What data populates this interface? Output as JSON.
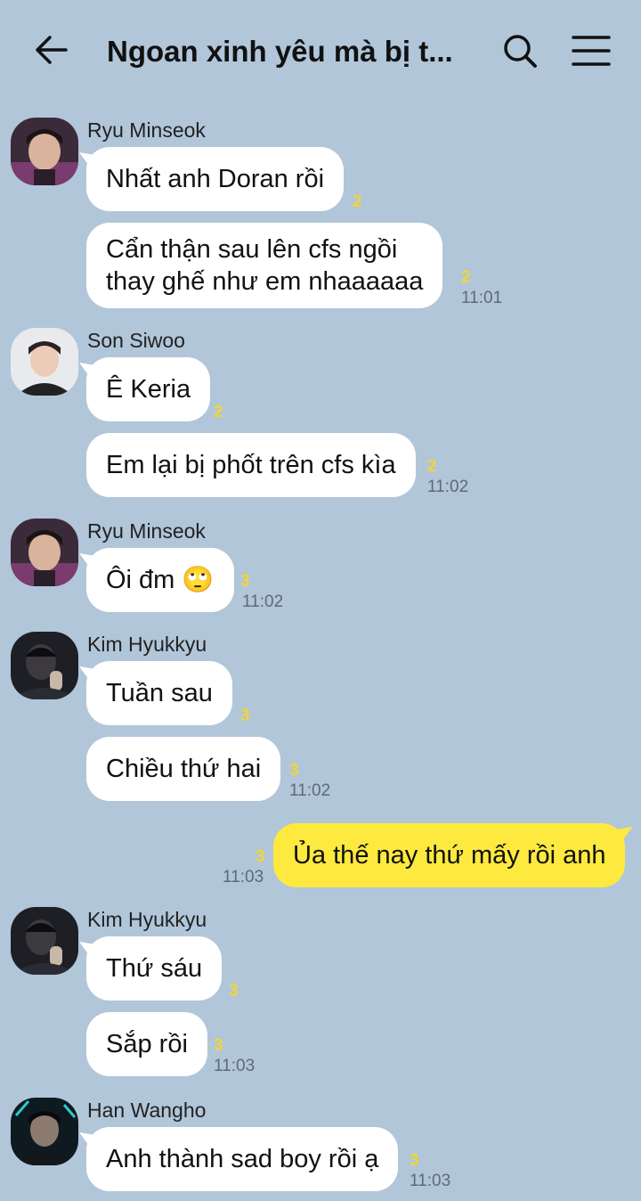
{
  "header": {
    "title": "Ngoan xinh yêu mà bị t..."
  },
  "messages": {
    "g1": {
      "sender": "Ryu Minseok",
      "m1": "Nhất anh Doran rồi",
      "m1_unread": "2",
      "m2_line1": "Cẩn thận sau lên cfs ngồi",
      "m2_line2": "thay ghế như em nhaaaaaa",
      "m2_unread": "2",
      "m2_time": "11:01"
    },
    "g2": {
      "sender": "Son Siwoo",
      "m1": "Ê Keria",
      "m1_unread": "2",
      "m2": "Em lại bị phốt trên cfs kìa",
      "m2_unread": "2",
      "m2_time": "11:02"
    },
    "g3": {
      "sender": "Ryu Minseok",
      "m1": "Ôi đm 🙄",
      "m1_unread": "3",
      "m1_time": "11:02"
    },
    "g4": {
      "sender": "Kim Hyukkyu",
      "m1": "Tuần sau",
      "m1_unread": "3",
      "m2": "Chiều thứ hai",
      "m2_unread": "3",
      "m2_time": "11:02"
    },
    "me1": {
      "text": "Ủa thế nay thứ mấy rồi anh",
      "unread": "3",
      "time": "11:03"
    },
    "g5": {
      "sender": "Kim Hyukkyu",
      "m1": "Thứ sáu",
      "m1_unread": "3",
      "m2": "Sắp rồi",
      "m2_unread": "3",
      "m2_time": "11:03"
    },
    "g6": {
      "sender": "Han Wangho",
      "m1": "Anh thành sad boy rồi ạ",
      "m1_unread": "3",
      "m1_time": "11:03"
    }
  },
  "colors": {
    "background": "#b1c6d9",
    "bubble_mine": "#fee93e",
    "bubble_other": "#ffffff",
    "unread": "#f3d530"
  }
}
